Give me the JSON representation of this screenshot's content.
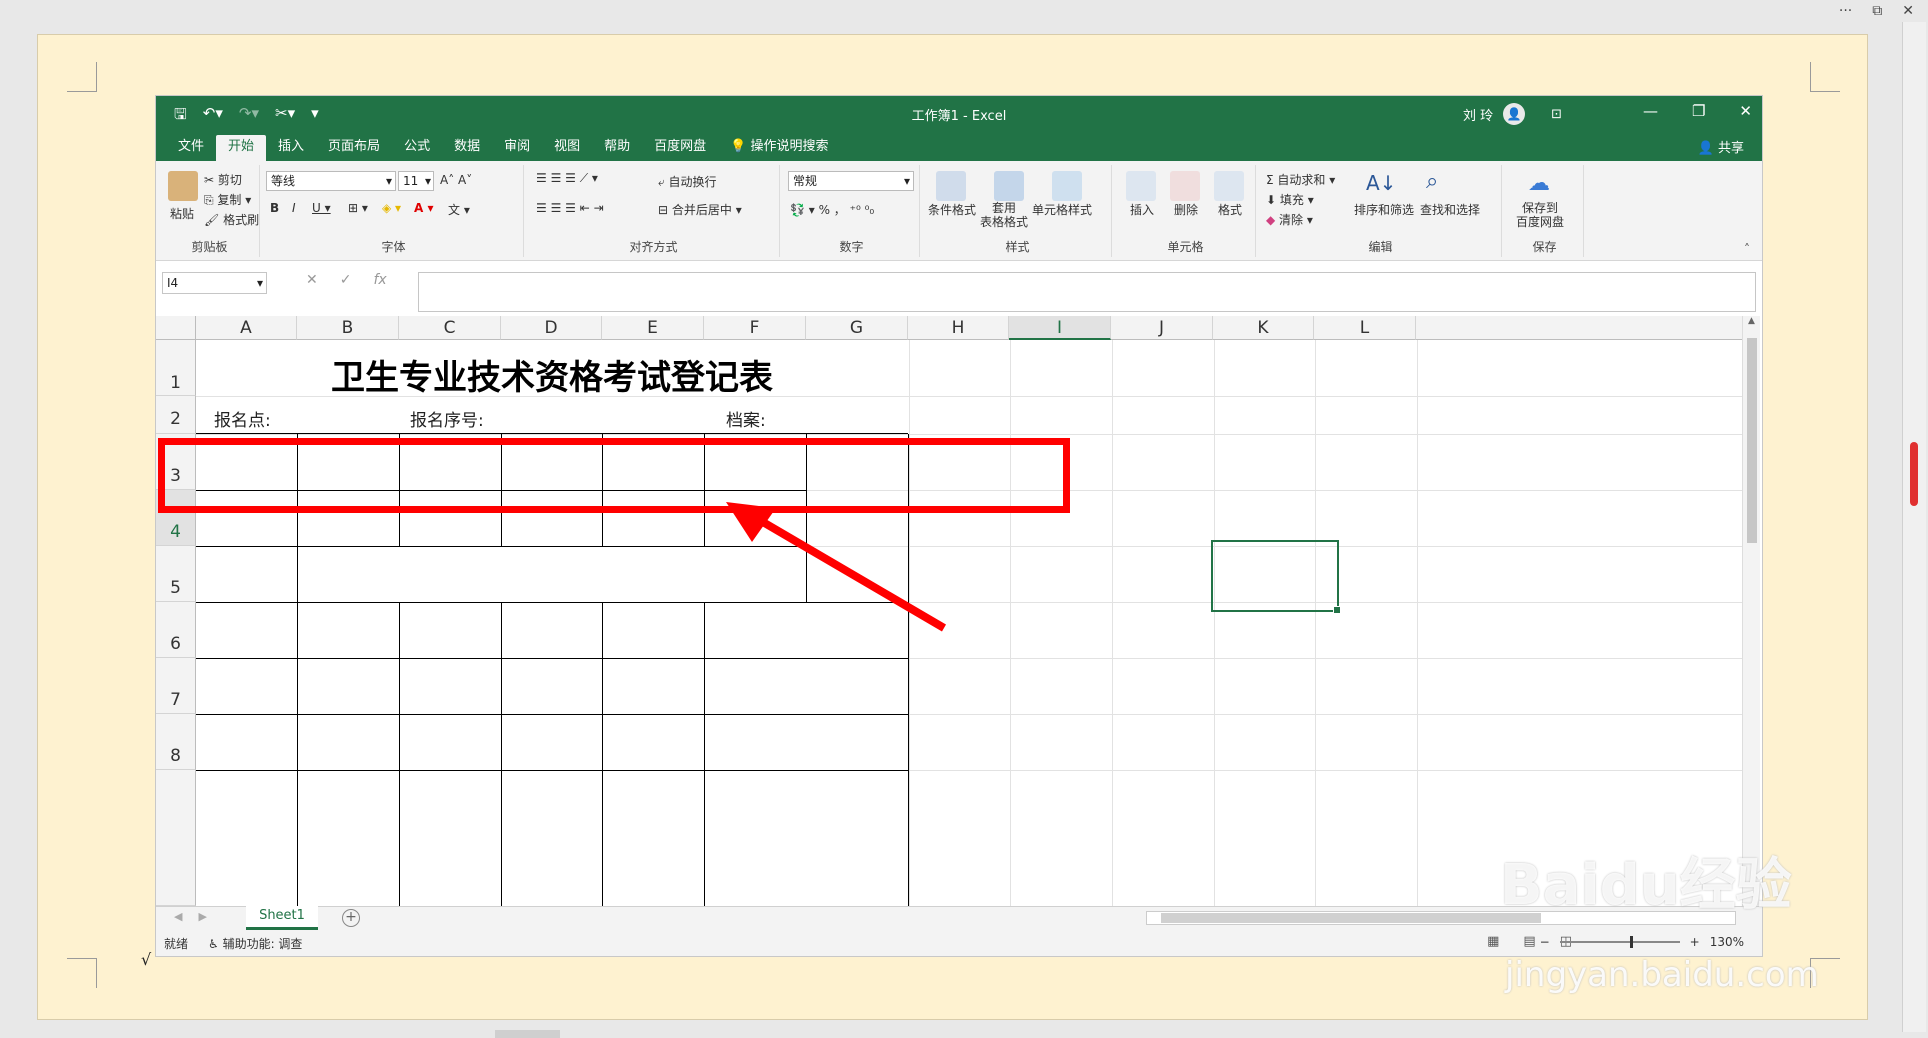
{
  "app": {
    "title": "工作簿1 - Excel",
    "user_name": "刘 玲",
    "share_label": "共享"
  },
  "tabs": [
    {
      "label": "文件"
    },
    {
      "label": "开始"
    },
    {
      "label": "插入"
    },
    {
      "label": "页面布局"
    },
    {
      "label": "公式"
    },
    {
      "label": "数据"
    },
    {
      "label": "审阅"
    },
    {
      "label": "视图"
    },
    {
      "label": "帮助"
    },
    {
      "label": "百度网盘"
    }
  ],
  "tell_me": "操作说明搜索",
  "ribbon": {
    "clipboard": {
      "group": "剪贴板",
      "paste": "粘贴",
      "cut": "剪切",
      "copy": "复制",
      "format_painter": "格式刷"
    },
    "font": {
      "group": "字体",
      "font_name": "等线",
      "font_size": "11"
    },
    "alignment": {
      "group": "对齐方式",
      "wrap": "自动换行",
      "merge": "合并后居中"
    },
    "number": {
      "group": "数字",
      "format": "常规"
    },
    "styles": {
      "group": "样式",
      "conditional": "条件格式",
      "table_format": "套用\n表格格式",
      "cell_styles": "单元格样式"
    },
    "cells": {
      "group": "单元格",
      "insert": "插入",
      "delete": "删除",
      "format": "格式"
    },
    "editing": {
      "group": "编辑",
      "autosum": "自动求和",
      "fill": "填充",
      "clear": "清除",
      "sort_filter": "排序和筛选",
      "find_select": "查找和选择"
    },
    "save": {
      "group": "保存",
      "save_baidu": "保存到\n百度网盘"
    }
  },
  "formula_bar": {
    "name_box": "I4",
    "formula": ""
  },
  "columns": [
    "A",
    "B",
    "C",
    "D",
    "E",
    "F",
    "G",
    "H",
    "I",
    "J",
    "K",
    "L"
  ],
  "rows": [
    "1",
    "2",
    "3",
    "4",
    "5",
    "6",
    "7",
    "8"
  ],
  "selected": {
    "column": "I",
    "row": "4"
  },
  "sheet": {
    "title": "卫生专业技术资格考试登记表",
    "row2": {
      "label_a": "报名点:",
      "label_c": "报名序号:",
      "label_f": "档案:"
    }
  },
  "sheet_tabs": [
    {
      "label": "Sheet1"
    }
  ],
  "status": {
    "ready": "就绪",
    "accessibility": "辅助功能: 调查",
    "zoom": "130%"
  },
  "watermark": {
    "brand": "Baidu经验",
    "url": "jingyan.baidu.com"
  }
}
